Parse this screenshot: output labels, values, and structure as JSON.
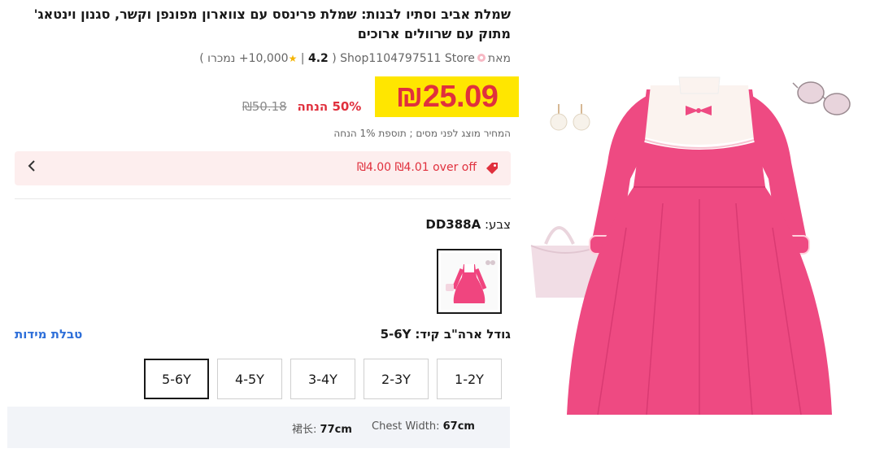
{
  "product": {
    "title": "שמלת אביב וסתיו לבנות: שמלת פרינסס עם צווארון מפונפן וקשר, סגנון וינטאג' מתוק עם שרוולים ארוכים",
    "store_prefix": "מאת",
    "store_name": "Shop1104797511 Store",
    "followers": "10,000",
    "rating": "4.2",
    "sold_label": "נמכרו",
    "sold_prefix": "+",
    "price": "₪25.09",
    "original_price": "₪50.18",
    "discount_label": "50% הנחה",
    "tax_note": "המחיר מוצג לפני מסים ; תוספת 1% הנחה",
    "coupon_text": "₪4.00 ₪4.01 over off",
    "color_label": "צבע:",
    "color_value": "DD388A",
    "size_label": "גודל ארה\"ב קיד:",
    "size_value": "5-6Y",
    "size_chart_link": "טבלת מידות",
    "sizes": [
      "5-6Y",
      "4-5Y",
      "3-4Y",
      "2-3Y",
      "1-2Y"
    ],
    "selected_size": "5-6Y",
    "measure_length_label": "裙长:",
    "measure_length_value": "77cm",
    "measure_chest_label": "Chest Width:",
    "measure_chest_value": "67cm"
  },
  "colors": {
    "price_highlight": "#ffe600",
    "price_red": "#e0303d",
    "coupon_bg": "#fdeeee",
    "link_blue": "#2e6fd9",
    "dress_pink": "#f0457f"
  },
  "icons": [
    "store-icon",
    "star-icon",
    "coupon-tag-icon",
    "chevron-left-icon"
  ]
}
